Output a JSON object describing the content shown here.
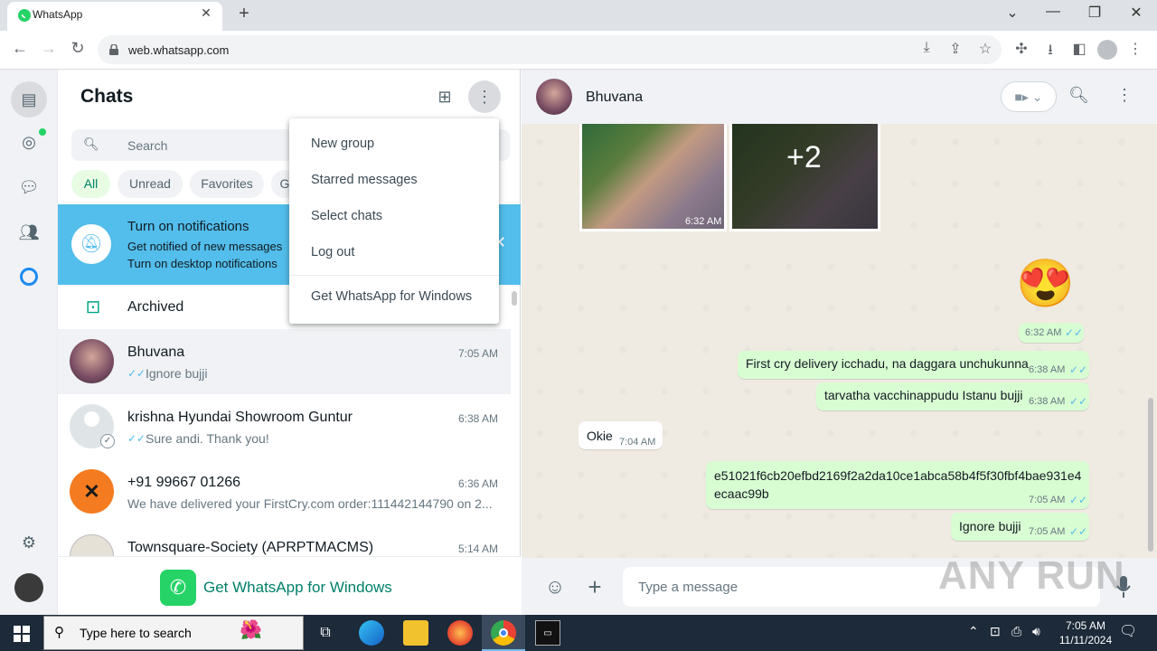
{
  "browser": {
    "tab_title": "WhatsApp",
    "url": "web.whatsapp.com"
  },
  "sidebar": {
    "title": "Chats",
    "search_placeholder": "Search",
    "filters": [
      "All",
      "Unread",
      "Favorites",
      "G"
    ],
    "notification": {
      "title": "Turn on notifications",
      "line1": "Get notified of new messages",
      "line2": "Turn on desktop notifications"
    },
    "archived_label": "Archived",
    "chats": [
      {
        "name": "Bhuvana",
        "time": "7:05 AM",
        "message": "Ignore bujji",
        "ticks": "✓✓"
      },
      {
        "name": "krishna Hyundai Showroom Guntur",
        "time": "6:38 AM",
        "message": "Sure andi. Thank you!",
        "ticks": "✓✓"
      },
      {
        "name": "+91 99667 01266",
        "time": "6:36 AM",
        "message": "We have delivered your FirstCry.com order:111442144790 on 2...",
        "ticks": ""
      },
      {
        "name": "Townsquare-Society (APRPTMACMS)",
        "time": "5:14 AM",
        "message": "",
        "ticks": ""
      }
    ],
    "get_app_label": "Get WhatsApp for Windows"
  },
  "menu": {
    "items": [
      "New group",
      "Starred messages",
      "Select chats",
      "Log out",
      "Get WhatsApp for Windows"
    ]
  },
  "conversation": {
    "contact_name": "Bhuvana",
    "photo_time": "6:32 AM",
    "photo_more": "+2",
    "emoji": "😍",
    "emoji_time": "6:32 AM",
    "messages": [
      {
        "text": "First cry delivery icchadu, na daggara unchukunna",
        "time": "6:38 AM",
        "dir": "out"
      },
      {
        "text": "tarvatha vacchinappudu Istanu bujji",
        "time": "6:38 AM",
        "dir": "out"
      },
      {
        "text": "Okie",
        "time": "7:04 AM",
        "dir": "in"
      },
      {
        "text": "e51021f6cb20efbd2169f2a2da10ce1abca58b4f5f30fbf4bae931e4",
        "text2": "ecaac99b",
        "time": "7:05 AM",
        "dir": "out"
      },
      {
        "text": "Ignore bujji",
        "time": "7:05 AM",
        "dir": "out"
      }
    ],
    "composer_placeholder": "Type a message",
    "watermark": "ANY RUN"
  },
  "taskbar": {
    "search_placeholder": "Type here to search",
    "time": "7:05 AM",
    "date": "11/11/2024"
  }
}
